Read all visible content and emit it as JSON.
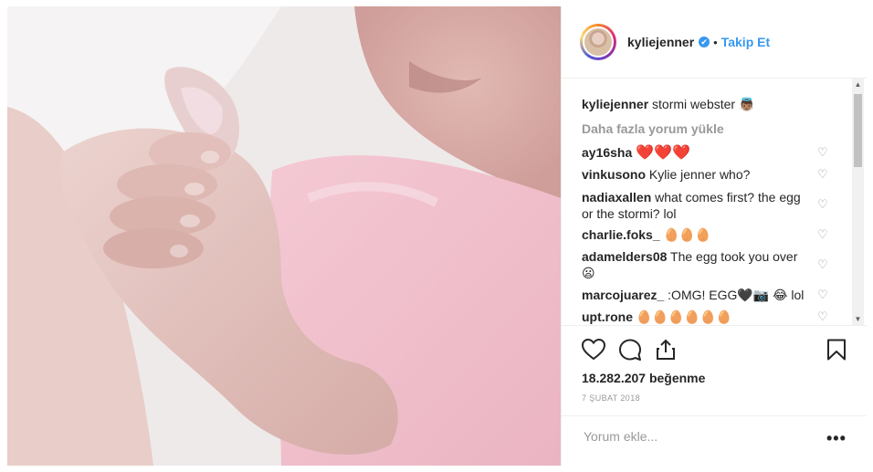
{
  "post": {
    "username": "kyliejenner",
    "verified_mark": "✔",
    "separator": "•",
    "follow_label": "Takip Et"
  },
  "caption": {
    "username": "kyliejenner",
    "text": "stormi webster 👼🏽"
  },
  "load_more": "Daha fazla yorum yükle",
  "comments": [
    {
      "username": "ay16sha",
      "text": "❤️❤️❤️"
    },
    {
      "username": "vinkusono",
      "text": "Kylie jenner who?"
    },
    {
      "username": "nadiaxallen",
      "text": "what comes first? the egg or the stormi? lol"
    },
    {
      "username": "charlie.foks_",
      "text": "🥚🥚🥚"
    },
    {
      "username": "adamelders08",
      "text": "The egg took you over 😦"
    },
    {
      "username": "marcojuarez_",
      "text": ":OMG! EGG🖤📷 😂 lol"
    },
    {
      "username": "upt.rone",
      "text": "🥚🥚🥚🥚🥚🥚"
    }
  ],
  "likes_text": "18.282.207 beğenme",
  "date_text": "7 ŞUBAT 2018",
  "comment_box": {
    "placeholder": "Yorum ekle..."
  },
  "more_glyph": "•••",
  "icons": [
    "heart-icon",
    "comment-icon",
    "share-icon",
    "bookmark-icon",
    "verified-icon"
  ],
  "colors": {
    "link": "#3897f0",
    "heart": "#ed4956",
    "muted": "#999999",
    "border": "#efefef"
  }
}
